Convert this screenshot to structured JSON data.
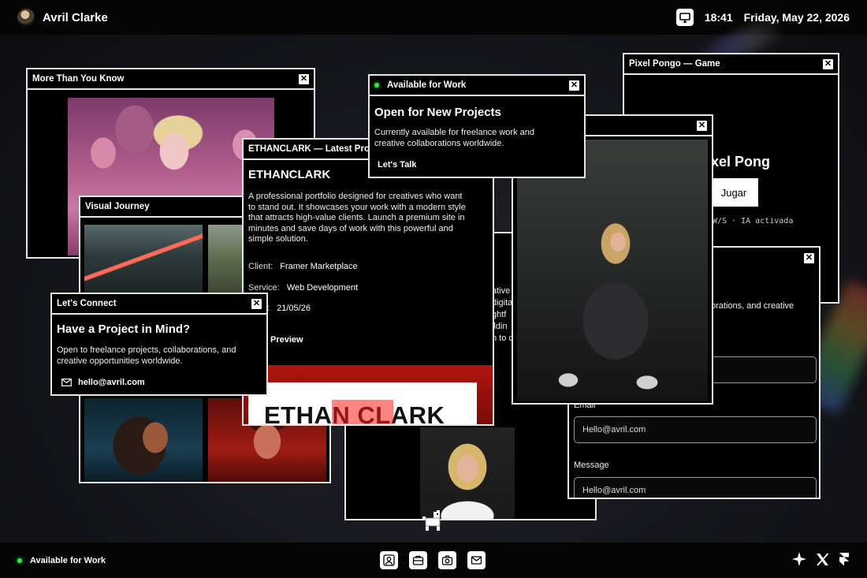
{
  "topbar": {
    "name": "Avril Clarke",
    "time": "18:41",
    "date": "Friday, May 22, 2026"
  },
  "bottombar": {
    "status": "Available for Work"
  },
  "windows": {
    "more": {
      "title": "More Than You Know"
    },
    "visual": {
      "title": "Visual Journey"
    },
    "connect": {
      "title": "Let's Connect",
      "heading": "Have a Project in Mind?",
      "body": "Open to freelance projects, collaborations, and creative opportunities worldwide.",
      "email": "hello@avril.com"
    },
    "project": {
      "title": "ETHANCLARK — Latest Proje",
      "heading": "ETHANCLARK",
      "body": "A professional portfolio designed for creatives who want to stand out. It showcases your work with a modern style that attracts high-value clients. Launch a premium site in minutes and save days of work with this powerful and simple solution.",
      "client_label": "Client:",
      "client": "Framer Marketplace",
      "service_label": "Service:",
      "service": "Web Development",
      "date_label": ":",
      "date": "21/05/26",
      "preview": "Preview",
      "banner": "ETHAN CLARK"
    },
    "behind": {
      "fragments": [
        "ative",
        "digita",
        "ghtf",
        "ildin",
        "n to c"
      ]
    },
    "available": {
      "title": "Available for Work",
      "heading": "Open for New Projects",
      "body": "Currently available for freelance work and creative collaborations worldwide.",
      "cta": "Let's Talk"
    },
    "pong": {
      "title": "Pixel Pongo —  Game",
      "game_title": "xel Pong",
      "play": "Jugar",
      "hint": "W/S · IA activada"
    },
    "contact": {
      "fragment": "orations, and creative",
      "email_label": "Email",
      "email_placeholder": "Hello@avril.com",
      "message_label": "Message",
      "message_placeholder": "Hello@avril.com"
    }
  }
}
